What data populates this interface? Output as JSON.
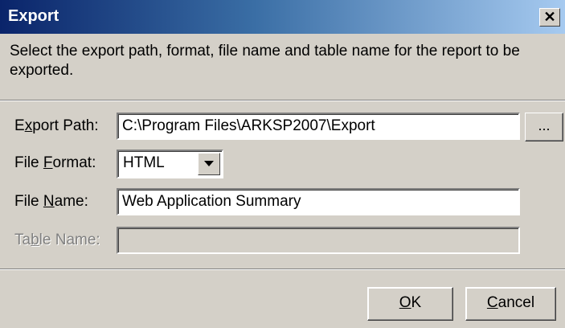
{
  "title": "Export",
  "close_icon": "close-icon",
  "description": "Select the export path, format, file name and table name for the report to be exported.",
  "export_path": {
    "label_pre": "E",
    "label_u": "x",
    "label_post": "port Path:",
    "value": "C:\\Program Files\\ARKSP2007\\Export",
    "browse_label": "..."
  },
  "file_format": {
    "label_pre": "File ",
    "label_u": "F",
    "label_post": "ormat:",
    "value": "HTML"
  },
  "file_name": {
    "label_pre": "File ",
    "label_u": "N",
    "label_post": "ame:",
    "value": "Web Application Summary"
  },
  "table_name": {
    "label_pre": "Ta",
    "label_u": "b",
    "label_post": "le Name:",
    "value": ""
  },
  "buttons": {
    "ok": {
      "u": "O",
      "rest": "K"
    },
    "cancel": {
      "u": "C",
      "rest": "ancel"
    }
  }
}
